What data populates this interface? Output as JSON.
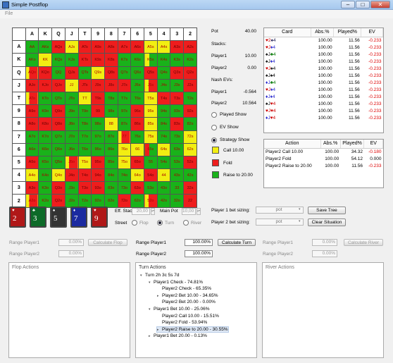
{
  "window": {
    "title": "Simple Postflop",
    "menu": "File"
  },
  "grid": {
    "cols": [
      "A",
      "K",
      "Q",
      "J",
      "T",
      "9",
      "8",
      "7",
      "6",
      "5",
      "4",
      "3",
      "2"
    ],
    "rows": [
      [
        "A",
        [
          "AA",
          "g"
        ],
        [
          "AKs",
          "g"
        ],
        [
          "AQs",
          "r"
        ],
        [
          "AJs",
          "y"
        ],
        [
          "ATs",
          "r"
        ],
        [
          "A9s",
          "r"
        ],
        [
          "A8s",
          "r"
        ],
        [
          "A7s",
          "r"
        ],
        [
          "A6s",
          "r"
        ],
        [
          "A5s",
          "y"
        ],
        [
          "A4s",
          "y"
        ],
        [
          "A3s",
          "r"
        ],
        [
          "A2s",
          "r"
        ]
      ],
      [
        "K",
        [
          "AKo",
          "g"
        ],
        [
          "KK",
          "y"
        ],
        [
          "KQs",
          "g"
        ],
        [
          "KJs",
          "g"
        ],
        [
          "KTs",
          "r"
        ],
        [
          "K9s",
          "r"
        ],
        [
          "K8s",
          "r"
        ],
        [
          "K7s",
          "g"
        ],
        [
          "K6s",
          "g"
        ],
        [
          "K5s",
          "gy"
        ],
        [
          "K4s",
          "g"
        ],
        [
          "K3s",
          "g"
        ],
        [
          "K2s",
          "g"
        ]
      ],
      [
        "Q",
        [
          "AQo",
          "ry"
        ],
        [
          "KQo",
          "r"
        ],
        [
          "QQ",
          "g"
        ],
        [
          "QJs",
          "r"
        ],
        [
          "QTs",
          "g"
        ],
        [
          "Q9s",
          "y"
        ],
        [
          "Q8s",
          "r"
        ],
        [
          "Q7s",
          "g"
        ],
        [
          "Q6s",
          "g"
        ],
        [
          "Q5s",
          "r"
        ],
        [
          "Q4s",
          "g"
        ],
        [
          "Q3s",
          "r"
        ],
        [
          "Q2s",
          "r"
        ]
      ],
      [
        "J",
        [
          "AJo",
          "r"
        ],
        [
          "KJo",
          "r"
        ],
        [
          "QJo",
          "r"
        ],
        [
          "JJ",
          "y"
        ],
        [
          "JTs",
          "r"
        ],
        [
          "J9s",
          "r"
        ],
        [
          "J8s",
          "r"
        ],
        [
          "J7s",
          "r"
        ],
        [
          "J6s",
          "g"
        ],
        [
          "J5s",
          "ry"
        ],
        [
          "J4s",
          "g"
        ],
        [
          "J3s",
          "g"
        ],
        [
          "J2s",
          "r"
        ]
      ],
      [
        "T",
        [
          "ATo",
          "ry"
        ],
        [
          "KTo",
          "g"
        ],
        [
          "QTo",
          "g"
        ],
        [
          "JTo",
          "g"
        ],
        [
          "TT",
          "y"
        ],
        [
          "T9s",
          "r"
        ],
        [
          "T8s",
          "g"
        ],
        [
          "T7s",
          "g"
        ],
        [
          "T6s",
          "g"
        ],
        [
          "T5s",
          "y"
        ],
        [
          "T4s",
          "r"
        ],
        [
          "T3s",
          "r"
        ],
        [
          "T2s",
          "g"
        ]
      ],
      [
        "9",
        [
          "A9o",
          "r"
        ],
        [
          "K9o",
          "g"
        ],
        [
          "Q9o",
          "r"
        ],
        [
          "J9o",
          "g"
        ],
        [
          "T9o",
          "g"
        ],
        [
          "99",
          "r"
        ],
        [
          "98s",
          "g"
        ],
        [
          "97s",
          "g"
        ],
        [
          "96s",
          "r"
        ],
        [
          "95s",
          "y"
        ],
        [
          "94s",
          "g"
        ],
        [
          "93s",
          "g"
        ],
        [
          "92s",
          "r"
        ]
      ],
      [
        "8",
        [
          "A8o",
          "r"
        ],
        [
          "K8o",
          "r"
        ],
        [
          "Q8o",
          "r"
        ],
        [
          "J8o",
          "g"
        ],
        [
          "T8o",
          "g"
        ],
        [
          "98o",
          "g"
        ],
        [
          "88",
          "y"
        ],
        [
          "87s",
          "g"
        ],
        [
          "86s",
          "r"
        ],
        [
          "85s",
          "y"
        ],
        [
          "84s",
          "g"
        ],
        [
          "83s",
          "r"
        ],
        [
          "82s",
          "g"
        ]
      ],
      [
        "7",
        [
          "A7o",
          "g"
        ],
        [
          "K7o",
          "g"
        ],
        [
          "Q7o",
          "g"
        ],
        [
          "J7o",
          "g"
        ],
        [
          "T7o",
          "g"
        ],
        [
          "97o",
          "g"
        ],
        [
          "87o",
          "g"
        ],
        [
          "77",
          "ry"
        ],
        [
          "76s",
          "g"
        ],
        [
          "75s",
          "y"
        ],
        [
          "74s",
          "g"
        ],
        [
          "73s",
          "g"
        ],
        [
          "72s",
          "y"
        ]
      ],
      [
        "6",
        [
          "A6o",
          "g"
        ],
        [
          "K6o",
          "g"
        ],
        [
          "Q6o",
          "g"
        ],
        [
          "J6o",
          "g"
        ],
        [
          "T6o",
          "g"
        ],
        [
          "96o",
          "g"
        ],
        [
          "86o",
          "g"
        ],
        [
          "76o",
          "y"
        ],
        [
          "66",
          "y"
        ],
        [
          "65s",
          "gr"
        ],
        [
          "64s",
          "y"
        ],
        [
          "63s",
          "g"
        ],
        [
          "62s",
          "y"
        ]
      ],
      [
        "5",
        [
          "A5o",
          "r"
        ],
        [
          "K5o",
          "g"
        ],
        [
          "Q5o",
          "g"
        ],
        [
          "J5o",
          "ry"
        ],
        [
          "T5o",
          "y"
        ],
        [
          "95o",
          "r"
        ],
        [
          "85o",
          "g"
        ],
        [
          "75o",
          "y"
        ],
        [
          "65o",
          "r"
        ],
        [
          "55",
          "g"
        ],
        [
          "54s",
          "g"
        ],
        [
          "53s",
          "g"
        ],
        [
          "52s",
          "r"
        ]
      ],
      [
        "4",
        [
          "A4o",
          "y"
        ],
        [
          "K4o",
          "g"
        ],
        [
          "Q4o",
          "y"
        ],
        [
          "J4o",
          "r"
        ],
        [
          "T4o",
          "r"
        ],
        [
          "94o",
          "r"
        ],
        [
          "84o",
          "g"
        ],
        [
          "74o",
          "g"
        ],
        [
          "64o",
          "y"
        ],
        [
          "54o",
          "r"
        ],
        [
          "44",
          "y"
        ],
        [
          "43s",
          "g"
        ],
        [
          "42s",
          "g"
        ]
      ],
      [
        "3",
        [
          "A3o",
          "r"
        ],
        [
          "K3o",
          "g"
        ],
        [
          "Q3o",
          "r"
        ],
        [
          "J3o",
          "g"
        ],
        [
          "T3o",
          "r"
        ],
        [
          "93o",
          "r"
        ],
        [
          "83o",
          "g"
        ],
        [
          "73o",
          "g"
        ],
        [
          "63o",
          "r"
        ],
        [
          "53o",
          "g"
        ],
        [
          "43o",
          "g"
        ],
        [
          "33",
          "g"
        ],
        [
          "32s",
          "r"
        ]
      ],
      [
        "2",
        [
          "A2o",
          "ry"
        ],
        [
          "K2o",
          "g"
        ],
        [
          "Q2o",
          "r"
        ],
        [
          "J2o",
          "g"
        ],
        [
          "T2o",
          "g"
        ],
        [
          "92o",
          "g"
        ],
        [
          "82o",
          "g"
        ],
        [
          "72o",
          "r"
        ],
        [
          "62o",
          "g"
        ],
        [
          "52o",
          "ry"
        ],
        [
          "42o",
          "g"
        ],
        [
          "32o",
          "g"
        ],
        [
          "22",
          "r"
        ]
      ]
    ]
  },
  "info": {
    "pot_label": "Pot",
    "pot_value": "40.00",
    "stacks_label": "Stacks:",
    "p1_label": "Player1",
    "p1_stack": "10.00",
    "p2_label": "Player2",
    "p2_stack": "0.00",
    "nash_label": "Nash EVs:",
    "p1_ev_label": "Player1",
    "p1_ev": "-0.564",
    "p2_ev_label": "Player2",
    "p2_ev": "10.564",
    "opt_played": "Played Show",
    "opt_ev": "EV Show",
    "opt_strategy": "Strategy Show",
    "leg_call": "Call 10.00",
    "leg_fold": "Fold",
    "leg_raise": "Raise to 20.00"
  },
  "colors": {
    "call": "#f2ee12",
    "fold": "#ee1d1d",
    "raise": "#19b21a"
  },
  "card_table": {
    "headers": [
      "Card",
      "Abs.%",
      "Played%",
      "EV"
    ],
    "rows": [
      {
        "a": "♥2",
        "ac": "#c00",
        "b": "♠4",
        "bc": "#225",
        "abs": "100.00",
        "played": "11.56",
        "ev": "-0.233"
      },
      {
        "a": "♥J",
        "ac": "#c00",
        "b": "♦4",
        "bc": "#22c",
        "abs": "100.00",
        "played": "11.56",
        "ev": "-0.233"
      },
      {
        "a": "♠J",
        "ac": "#000",
        "b": "♣4",
        "bc": "#070",
        "abs": "100.00",
        "played": "11.56",
        "ev": "-0.233"
      },
      {
        "a": "♠J",
        "ac": "#000",
        "b": "♦4",
        "bc": "#22c",
        "abs": "100.00",
        "played": "11.56",
        "ev": "-0.233"
      },
      {
        "a": "♥J",
        "ac": "#c00",
        "b": "♠4",
        "bc": "#000",
        "abs": "100.00",
        "played": "11.56",
        "ev": "-0.233"
      },
      {
        "a": "♠J",
        "ac": "#000",
        "b": "♠4",
        "bc": "#000",
        "abs": "100.00",
        "played": "11.56",
        "ev": "-0.233"
      },
      {
        "a": "♦J",
        "ac": "#22c",
        "b": "♣4",
        "bc": "#070",
        "abs": "100.00",
        "played": "11.56",
        "ev": "-0.233"
      },
      {
        "a": "♥J",
        "ac": "#c00",
        "b": "♦4",
        "bc": "#22c",
        "abs": "100.00",
        "played": "11.56",
        "ev": "-0.233"
      },
      {
        "a": "♦J",
        "ac": "#22c",
        "b": "♦4",
        "bc": "#22c",
        "abs": "100.00",
        "played": "11.56",
        "ev": "-0.233"
      },
      {
        "a": "♠J",
        "ac": "#000",
        "b": "♥4",
        "bc": "#c00",
        "abs": "100.00",
        "played": "11.56",
        "ev": "-0.233"
      },
      {
        "a": "♥J",
        "ac": "#c00",
        "b": "♥4",
        "bc": "#c00",
        "abs": "100.00",
        "played": "11.56",
        "ev": "-0.233"
      },
      {
        "a": "♦J",
        "ac": "#22c",
        "b": "♥4",
        "bc": "#c00",
        "abs": "100.00",
        "played": "11.56",
        "ev": "-0.233"
      }
    ]
  },
  "action_table": {
    "headers": [
      "Action",
      "Abs.%",
      "Played%",
      "EV"
    ],
    "rows": [
      {
        "name": "Player2 Call 10.00",
        "abs": "100.00",
        "played": "34.32",
        "ev": "-0.180"
      },
      {
        "name": "Player2 Fold",
        "abs": "100.00",
        "played": "54.12",
        "ev": "0.000"
      },
      {
        "name": "Player2 Raise to 20.00",
        "abs": "100.00",
        "played": "11.56",
        "ev": "-0.233"
      }
    ]
  },
  "board": [
    {
      "rank": "2",
      "suit": "♥",
      "bg": "#b01818"
    },
    {
      "rank": "3",
      "suit": "♣",
      "bg": "#0d6a28"
    },
    {
      "rank": "5",
      "suit": "♠",
      "bg": "#333333"
    },
    {
      "rank": "7",
      "suit": "♦",
      "bg": "#1b2aa0"
    },
    {
      "rank": "9",
      "suit": "♥",
      "bg": "#b01818"
    }
  ],
  "controls": {
    "eff_stack_label": "Eff. Stack",
    "eff_stack": "20,00",
    "main_pot_label": "Main Pot",
    "main_pot": "10,00",
    "street_label": "Street",
    "street_flop": "Flop",
    "street_turn": "Turn",
    "street_river": "River",
    "p1_bet_label": "Player 1 bet sizing:",
    "p1_bet": "pot",
    "p2_bet_label": "Player 2 bet sizing:",
    "p2_bet": "pot",
    "save_tree": "Save Tree",
    "clear_situation": "Clear Situation"
  },
  "ranges": {
    "flop": {
      "p1": "Range Player1",
      "p1v": "0.00%",
      "p2": "Range Player2",
      "p2v": "0.00%",
      "btn": "Calculate Flop"
    },
    "turn": {
      "p1": "Range Player1",
      "p1v": "100.00%",
      "p2": "Range Player2",
      "p2v": "100.00%",
      "btn": "Calculate Turn"
    },
    "river": {
      "p1": "Range Player1",
      "p1v": "0.00%",
      "p2": "Range Player2",
      "p2v": "0.00%",
      "btn": "Calculate River"
    }
  },
  "panels": {
    "flop": "Flop Actions",
    "turn": "Turn Actions",
    "river": "River Actions"
  },
  "tree": [
    {
      "text": "Turn 2h 3c 5s 7d",
      "indent": 0,
      "icon": "▾",
      "sel": false
    },
    {
      "text": "Player1 Check - 74.81%",
      "indent": 1,
      "icon": "▾",
      "sel": false
    },
    {
      "text": "Player2 Check - 65.35%",
      "indent": 2,
      "icon": "",
      "sel": false
    },
    {
      "text": "Player2 Bet 10.00 - 34.65%",
      "indent": 2,
      "icon": "▸",
      "sel": false
    },
    {
      "text": "Player2 Bet 20.00 - 0.00%",
      "indent": 2,
      "icon": "",
      "sel": false
    },
    {
      "text": "Player1 Bet 10.00 - 25.06%",
      "indent": 1,
      "icon": "▾",
      "sel": false
    },
    {
      "text": "Player2 Call 10.00 - 15.51%",
      "indent": 2,
      "icon": "",
      "sel": false
    },
    {
      "text": "Player2 Fold - 53.94%",
      "indent": 2,
      "icon": "",
      "sel": false
    },
    {
      "text": "Player2 Raise to 20.00 - 30.55%",
      "indent": 2,
      "icon": "▸",
      "sel": true
    },
    {
      "text": "Player1 Bet 20.00 - 0.13%",
      "indent": 1,
      "icon": "▸",
      "sel": false
    }
  ]
}
